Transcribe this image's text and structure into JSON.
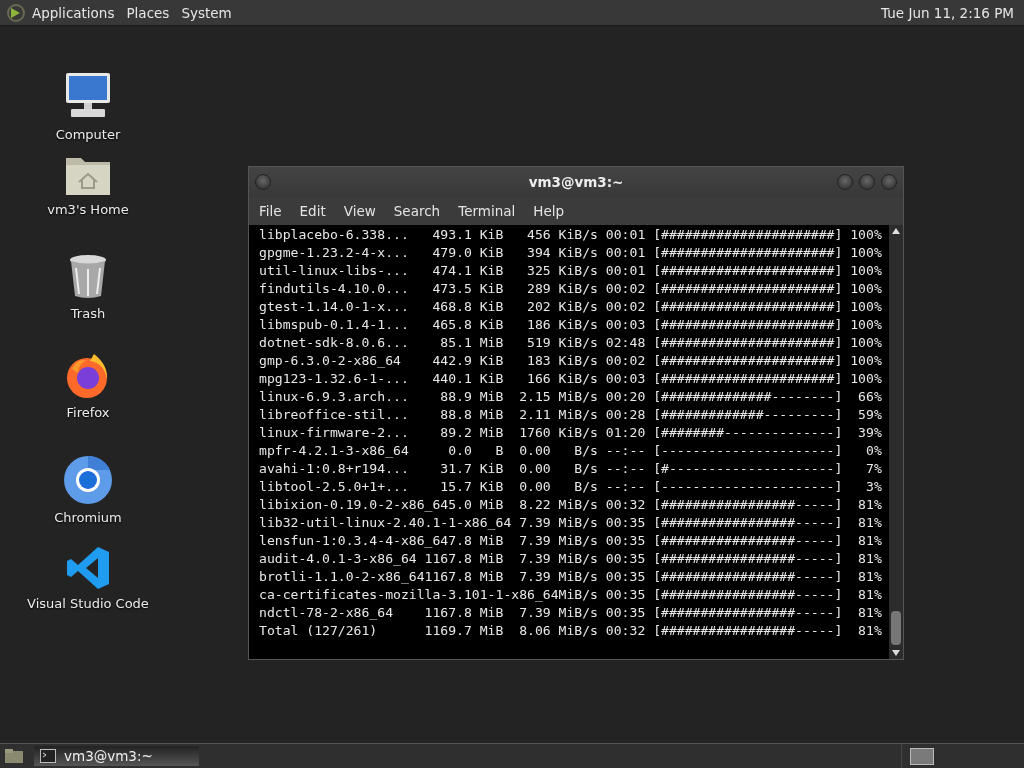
{
  "top_panel": {
    "menus": [
      "Applications",
      "Places",
      "System"
    ],
    "clock": "Tue Jun 11,  2:16 PM"
  },
  "desktop_icons": [
    {
      "kind": "computer",
      "label": "Computer"
    },
    {
      "kind": "home",
      "label": "vm3's Home"
    },
    {
      "kind": "trash",
      "label": "Trash"
    },
    {
      "kind": "firefox",
      "label": "Firefox"
    },
    {
      "kind": "chromium",
      "label": "Chromium"
    },
    {
      "kind": "vscode",
      "label": "Visual Studio Code"
    }
  ],
  "window": {
    "title": "vm3@vm3:~",
    "menu": [
      "File",
      "Edit",
      "View",
      "Search",
      "Terminal",
      "Help"
    ],
    "lines": [
      "libplacebo-6.338...   493.1 KiB   456 KiB/s 00:01 [######################] 100%",
      "gpgme-1.23.2-4-x...   479.0 KiB   394 KiB/s 00:01 [######################] 100%",
      "util-linux-libs-...   474.1 KiB   325 KiB/s 00:01 [######################] 100%",
      "findutils-4.10.0...   473.5 KiB   289 KiB/s 00:02 [######################] 100%",
      "gtest-1.14.0-1-x...   468.8 KiB   202 KiB/s 00:02 [######################] 100%",
      "libmspub-0.1.4-1...   465.8 KiB   186 KiB/s 00:03 [######################] 100%",
      "dotnet-sdk-8.0.6...    85.1 MiB   519 KiB/s 02:48 [######################] 100%",
      "gmp-6.3.0-2-x86_64    442.9 KiB   183 KiB/s 00:02 [######################] 100%",
      "mpg123-1.32.6-1-...   440.1 KiB   166 KiB/s 00:03 [######################] 100%",
      "linux-6.9.3.arch...    88.9 MiB  2.15 MiB/s 00:20 [##############--------]  66%",
      "libreoffice-stil...    88.8 MiB  2.11 MiB/s 00:28 [#############---------]  59%",
      "linux-firmware-2...    89.2 MiB  1760 KiB/s 01:20 [########--------------]  39%",
      "mpfr-4.2.1-3-x86_64     0.0   B  0.00   B/s --:-- [----------------------]   0%",
      "avahi-1:0.8+r194...    31.7 KiB  0.00   B/s --:-- [#---------------------]   7%",
      "libtool-2.5.0+1+...    15.7 KiB  0.00   B/s --:-- [----------------------]   3%",
      "libixion-0.19.0-2-x86_645.0 MiB  8.22 MiB/s 00:32 [#################-----]  81%",
      "lib32-util-linux-2.40.1-1-x86_64 7.39 MiB/s 00:35 [#################-----]  81%",
      "lensfun-1:0.3.4-4-x86_647.8 MiB  7.39 MiB/s 00:35 [#################-----]  81%",
      "audit-4.0.1-3-x86_64 1167.8 MiB  7.39 MiB/s 00:35 [#################-----]  81%",
      "brotli-1.1.0-2-x86_641167.8 MiB  7.39 MiB/s 00:35 [#################-----]  81%",
      "ca-certificates-mozilla-3.101-1-x86_64MiB/s 00:35 [#################-----]  81%",
      "ndctl-78-2-x86_64    1167.8 MiB  7.39 MiB/s 00:35 [#################-----]  81%",
      "Total (127/261)      1169.7 MiB  8.06 MiB/s 00:32 [#################-----]  81%"
    ]
  },
  "taskbar": {
    "tasks": [
      {
        "label": "vm3@vm3:~",
        "selected": true
      }
    ]
  }
}
